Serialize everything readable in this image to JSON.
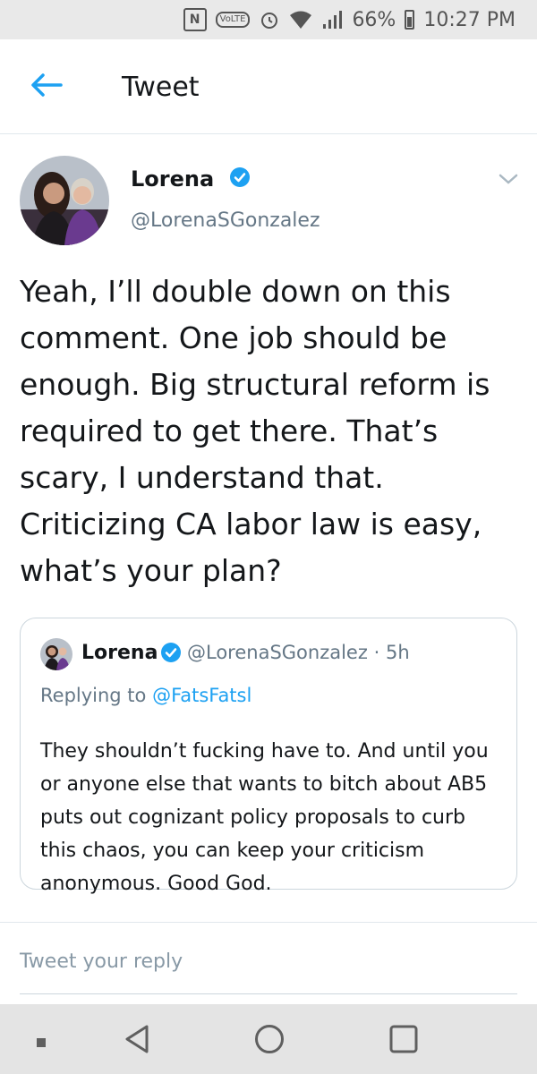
{
  "status_bar": {
    "nfc": "N",
    "volte": "VoLTE",
    "battery_percent": "66%",
    "time": "10:27 PM",
    "icons": [
      "nfc-icon",
      "volte-icon",
      "alarm-icon",
      "wifi-icon",
      "signal-icon",
      "battery-icon"
    ]
  },
  "header": {
    "title": "Tweet",
    "back_icon": "back-arrow-icon"
  },
  "tweet": {
    "author_name": "Lorena",
    "author_handle": "@LorenaSGonzalez",
    "text": "Yeah, I’ll double down on this comment. One job should be enough. Big structural reform is required to get there. That’s scary, I understand that. Criticizing CA labor law is easy, what’s your plan?"
  },
  "quoted_tweet": {
    "author_name": "Lorena",
    "author_handle": "@LorenaSGonzalez",
    "separator": "·",
    "age": "5h",
    "replying_prefix": "Replying to",
    "replying_to": "@FatsFatsl",
    "text": "They shouldn’t fucking have to. And until you or anyone else that wants to bitch about AB5 puts out cognizant policy proposals to curb this chaos, you can keep your criticism anonymous. Good God."
  },
  "reply": {
    "placeholder": "Tweet your reply"
  },
  "nav_bar": {
    "buttons": [
      "recent-apps-icon",
      "back-icon",
      "home-icon",
      "overview-icon"
    ]
  },
  "colors": {
    "accent": "#1da1f2",
    "secondary_text": "#657786",
    "primary_text": "#14171a"
  }
}
